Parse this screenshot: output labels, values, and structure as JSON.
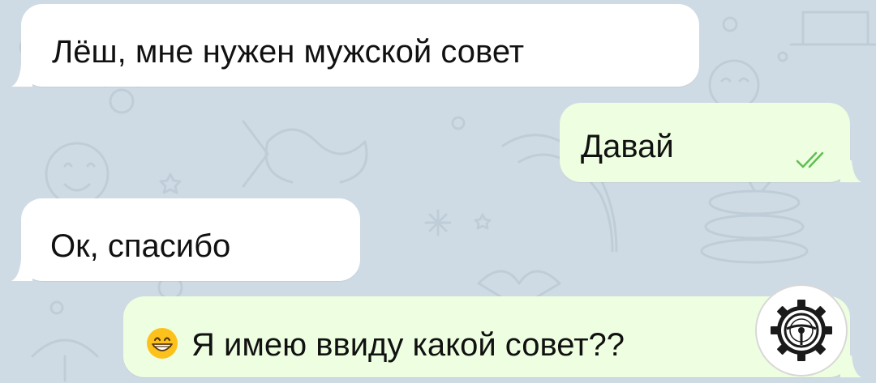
{
  "chat": {
    "messages": [
      {
        "direction": "incoming",
        "text": "Лёш, мне нужен мужской совет"
      },
      {
        "direction": "outgoing",
        "text": "Давай",
        "status": "read"
      },
      {
        "direction": "incoming",
        "text": "Ок, спасибо"
      },
      {
        "direction": "outgoing",
        "text": "Я имею ввиду какой совет??",
        "emoji": "grinning-face-with-smiling-eyes"
      }
    ]
  },
  "colors": {
    "background": "#cfdbe4",
    "incoming_bubble": "#ffffff",
    "outgoing_bubble": "#eefee0",
    "read_ticks": "#5fbf53",
    "text": "#111111"
  },
  "watermark": {
    "icon": "gear-steering-wheel-logo"
  }
}
